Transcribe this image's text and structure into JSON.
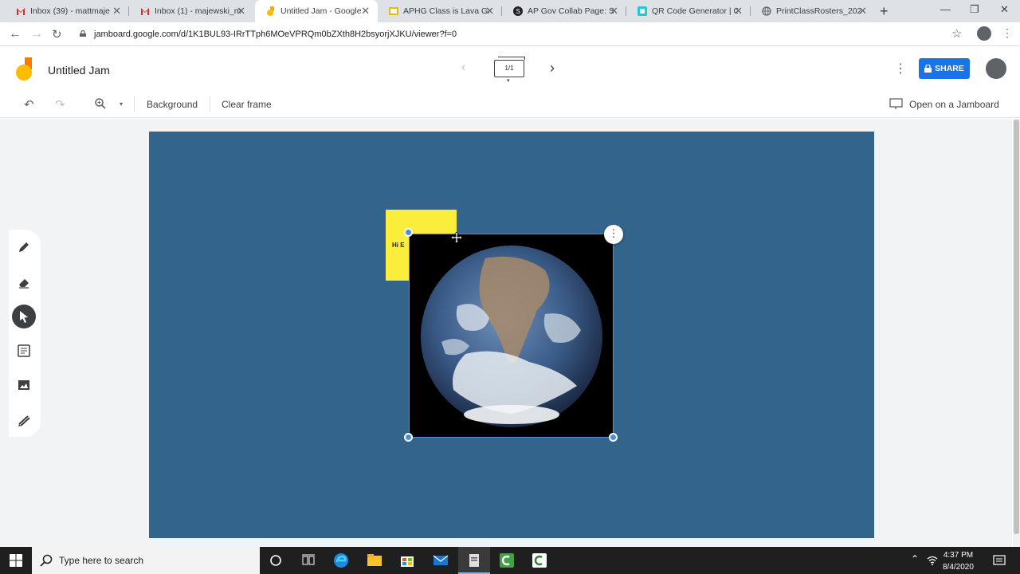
{
  "browser": {
    "tabs": [
      {
        "title": "Inbox (39) - mattmaje",
        "icon": "gmail-icon",
        "active": false
      },
      {
        "title": "Inbox (1) - majewski_m",
        "icon": "gmail-icon",
        "active": false
      },
      {
        "title": "Untitled Jam - Google",
        "icon": "jamboard-icon",
        "active": true
      },
      {
        "title": "APHG Class is Lava Ga",
        "icon": "slides-icon",
        "active": false
      },
      {
        "title": "AP Gov Collab Page: Se",
        "icon": "sites-icon",
        "active": false
      },
      {
        "title": "QR Code Generator | C",
        "icon": "qr-icon",
        "active": false
      },
      {
        "title": "PrintClassRosters_2020",
        "icon": "globe-icon",
        "active": false
      }
    ],
    "url": "jamboard.google.com/d/1K1BUL93-IRrTTph6MOeVPRQm0bZXth8H2bsyorjXJKU/viewer?f=0"
  },
  "app": {
    "title": "Untitled Jam",
    "frame_counter": "1/1",
    "share_label": "SHARE",
    "toolbar": {
      "background_label": "Background",
      "clear_frame_label": "Clear frame",
      "open_on_jamboard_label": "Open on a Jamboard"
    },
    "sticky_note_text": "Hi E",
    "board_color": "#33648b",
    "sticky_color": "#fbed3b",
    "accent": "#1a73e8"
  },
  "taskbar": {
    "search_placeholder": "Type here to search",
    "time": "4:37 PM",
    "date": "8/4/2020"
  }
}
